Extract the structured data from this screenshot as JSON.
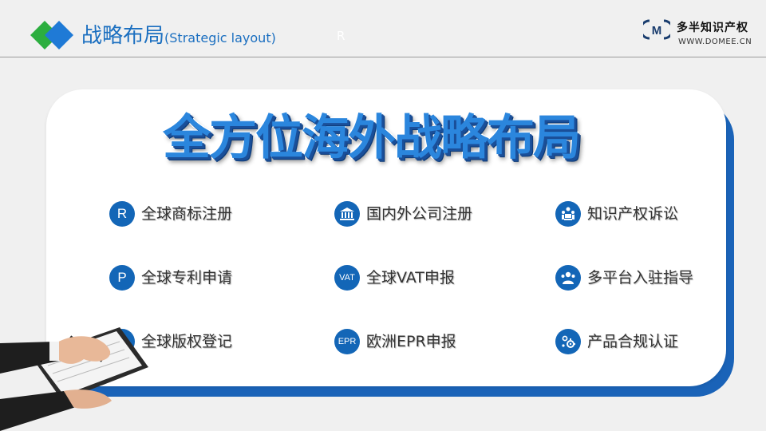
{
  "header": {
    "title_cn": "战略布局",
    "title_en": "(Strategic layout)",
    "stray_mark": "R"
  },
  "brand": {
    "logo_letter": "M",
    "name": "多半知识产权",
    "url": "WWW.DOMEE.CN"
  },
  "headline": "全方位海外战略布局",
  "colors": {
    "primary_blue": "#1366b7",
    "accent_green": "#2cae3f",
    "accent_blue": "#1f7ad6",
    "background": "#f0f0f0"
  },
  "services": [
    {
      "icon_text": "R",
      "icon": "letter-r-icon",
      "label": "全球商标注册"
    },
    {
      "icon_text": "",
      "icon": "building-icon",
      "label": "国内外公司注册"
    },
    {
      "icon_text": "",
      "icon": "meeting-icon",
      "label": "知识产权诉讼"
    },
    {
      "icon_text": "P",
      "icon": "letter-p-icon",
      "label": "全球专利申请"
    },
    {
      "icon_text": "VAT",
      "icon": "vat-icon",
      "label": "全球VAT申报"
    },
    {
      "icon_text": "",
      "icon": "people-icon",
      "label": "多平台入驻指导"
    },
    {
      "icon_text": "C",
      "icon": "letter-c-icon",
      "label": "全球版权登记"
    },
    {
      "icon_text": "EPR",
      "icon": "epr-icon",
      "label": "欧洲EPR申报"
    },
    {
      "icon_text": "",
      "icon": "gears-icon",
      "label": "产品合规认证"
    }
  ]
}
